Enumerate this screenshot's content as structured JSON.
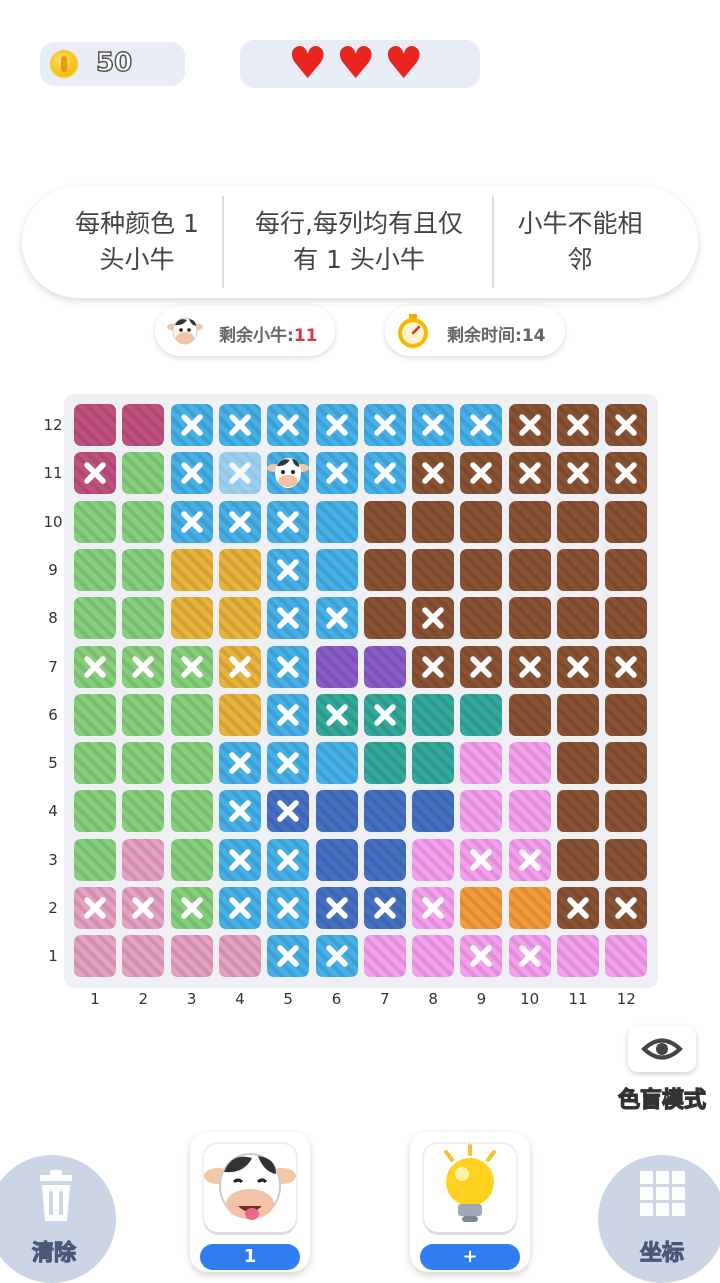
{
  "status": {
    "coins": "50",
    "hearts": [
      "♥",
      "♥",
      "♥"
    ]
  },
  "rules": [
    "每种颜色 1 头小牛",
    "每行,每列均有且仅有 1 头小牛",
    "小牛不能相邻"
  ],
  "counters": {
    "cows_label": "剩余小牛:",
    "cows_value": "11",
    "time_label": "剩余时间:",
    "time_value": "14"
  },
  "board": {
    "size": 12,
    "row_labels": [
      "12",
      "11",
      "10",
      "9",
      "8",
      "7",
      "6",
      "5",
      "4",
      "3",
      "2",
      "1"
    ],
    "col_labels": [
      "1",
      "2",
      "3",
      "4",
      "5",
      "6",
      "7",
      "8",
      "9",
      "10",
      "11",
      "12"
    ],
    "legend": {
      "M": {
        "name": "magenta",
        "color": "#c0517f"
      },
      "G": {
        "name": "green",
        "color": "#86d07d"
      },
      "B": {
        "name": "light-blue",
        "color": "#46b1e8"
      },
      "Y": {
        "name": "yellow",
        "color": "#e9b43c"
      },
      "R": {
        "name": "brown",
        "color": "#8a5233"
      },
      "P": {
        "name": "purple",
        "color": "#8a5cc9"
      },
      "T": {
        "name": "teal",
        "color": "#33a99b"
      },
      "K": {
        "name": "pink",
        "color": "#f5a0ee"
      },
      "D": {
        "name": "dark-blue",
        "color": "#4570c2"
      },
      "L": {
        "name": "rose",
        "color": "#e6a0c2"
      },
      "O": {
        "name": "orange",
        "color": "#f59a3a"
      }
    },
    "rows": [
      "MMBBBBBBBRRR",
      "MGBBBBBRRRRR",
      "GGBBBBRRRRRR",
      "GGYYBBRRRRRR",
      "GGYYBBRRRRRR",
      "GGGYBPPRRRRR",
      "GGGYBTTTTRRR",
      "GGGBBBTTKKRR",
      "GGGBDDDDKKRR",
      "GLGBBDDKKKRR",
      "LLGBBDDKOORR",
      "LLLLBBKKKKKK"
    ],
    "marks": [
      "..XXXXXXXXXX",
      "X.XX.XXXXXXX",
      "..XXX.......",
      "....X.......",
      "....XX.X....",
      "XXXXX..XXXXX",
      "....XXX.....",
      "...XX.......",
      "...XX.......",
      "...XX...XX..",
      "XXXXXXXX..XX",
      "....XX..XX.."
    ],
    "cow": {
      "row": "11",
      "col": "5"
    },
    "highlight": {
      "row": "11",
      "col": "4"
    }
  },
  "colorblind": {
    "label": "色盲模式",
    "icon": "eye-icon"
  },
  "bottom": {
    "clear_label": "清除",
    "coord_label": "坐标",
    "cow_count": "1",
    "hint_label": "+"
  }
}
